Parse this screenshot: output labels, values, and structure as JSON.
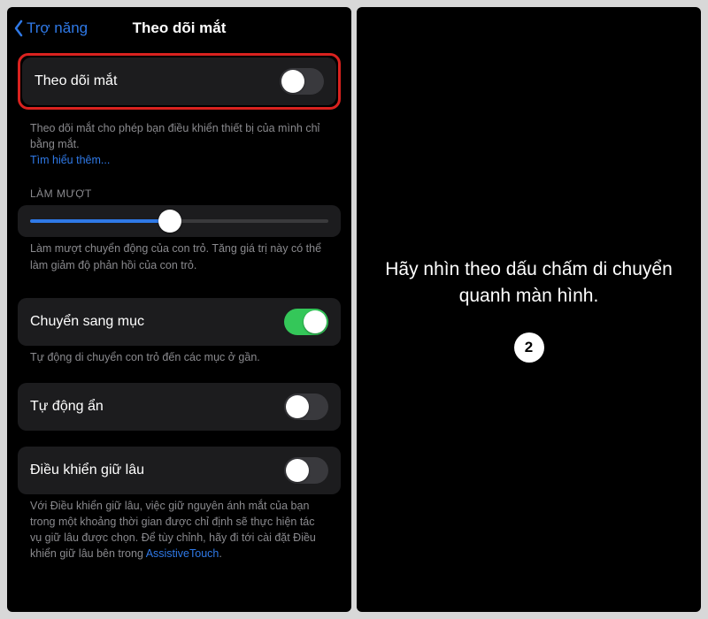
{
  "left": {
    "back_label": "Trợ năng",
    "title": "Theo dõi mắt",
    "eye_tracking": {
      "label": "Theo dõi mắt",
      "on": false,
      "desc": "Theo dõi mắt cho phép bạn điều khiển thiết bị của mình chỉ bằng mắt.",
      "learn_more": "Tìm hiểu thêm..."
    },
    "smoothing": {
      "header": "LÀM MƯỢT",
      "percent": 47,
      "desc": "Làm mượt chuyển động của con trỏ. Tăng giá trị này có thể làm giảm độ phản hồi của con trỏ."
    },
    "snap": {
      "label": "Chuyển sang mục",
      "on": true,
      "desc": "Tự động di chuyển con trỏ đến các mục ở gần."
    },
    "auto_hide": {
      "label": "Tự động ẩn",
      "on": false
    },
    "dwell": {
      "label": "Điều khiển giữ lâu",
      "on": false,
      "desc_a": "Với Điều khiển giữ lâu, việc giữ nguyên ánh mắt của bạn trong một khoảng thời gian được chỉ định sẽ thực hiện tác vụ giữ lâu được chọn. Để tùy chỉnh, hãy đi tới cài đặt Điều khiển giữ lâu bên trong ",
      "desc_link": "AssistiveTouch",
      "desc_b": "."
    }
  },
  "right": {
    "prompt": "Hãy nhìn theo dấu chấm di chuyển quanh màn hình.",
    "step": "2"
  }
}
